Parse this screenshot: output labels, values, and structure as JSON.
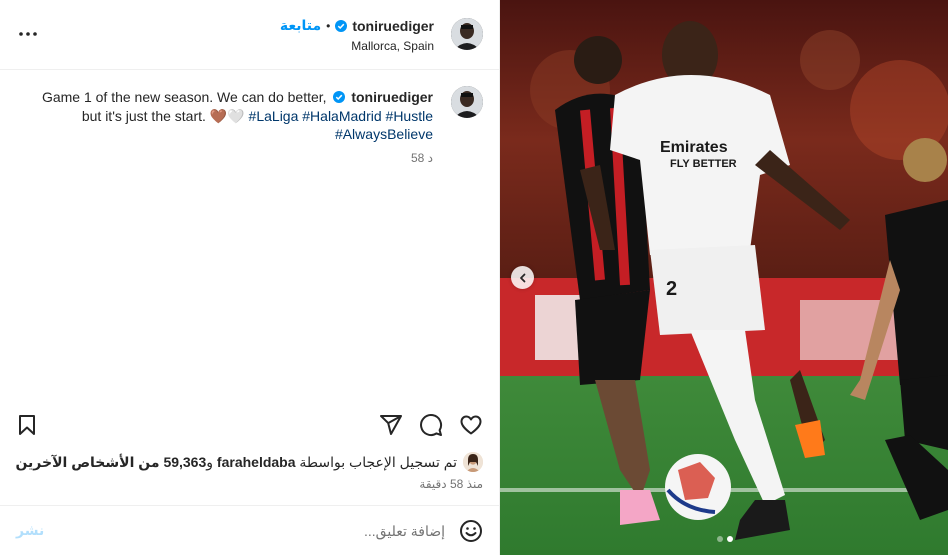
{
  "header": {
    "username": "toniruediger",
    "follow_label": "متابعة",
    "separator": "•",
    "location": "Mallorca, Spain"
  },
  "caption": {
    "username": "toniruediger",
    "line1_text": "Game 1 of the new season. We can do better,",
    "line2_text": "but it's just the start. 🤎🤍",
    "hashtags": [
      "#LaLiga",
      "#HalaMadrid",
      "#Hustle",
      "#AlwaysBelieve"
    ],
    "time": "58 د"
  },
  "actions": {
    "icons": [
      "bookmark-icon",
      "share-icon",
      "comment-icon",
      "heart-icon"
    ]
  },
  "likes": {
    "prefix": "تم تسجيل الإعجاب بواسطة",
    "liker": "faraheldaba",
    "conjunction": "و",
    "count": "59,363",
    "suffix": "من الأشخاص الآخرين",
    "time": "منذ 58 دقيقة"
  },
  "comment_bar": {
    "placeholder": "إضافة تعليق...",
    "post_label": "نشر"
  },
  "carousel": {
    "page_count": 2,
    "active_page": 1
  },
  "colors": {
    "link_blue": "#0095f6",
    "hashtag": "#00376b",
    "muted": "#737373",
    "post_disabled": "#b2dffc"
  }
}
